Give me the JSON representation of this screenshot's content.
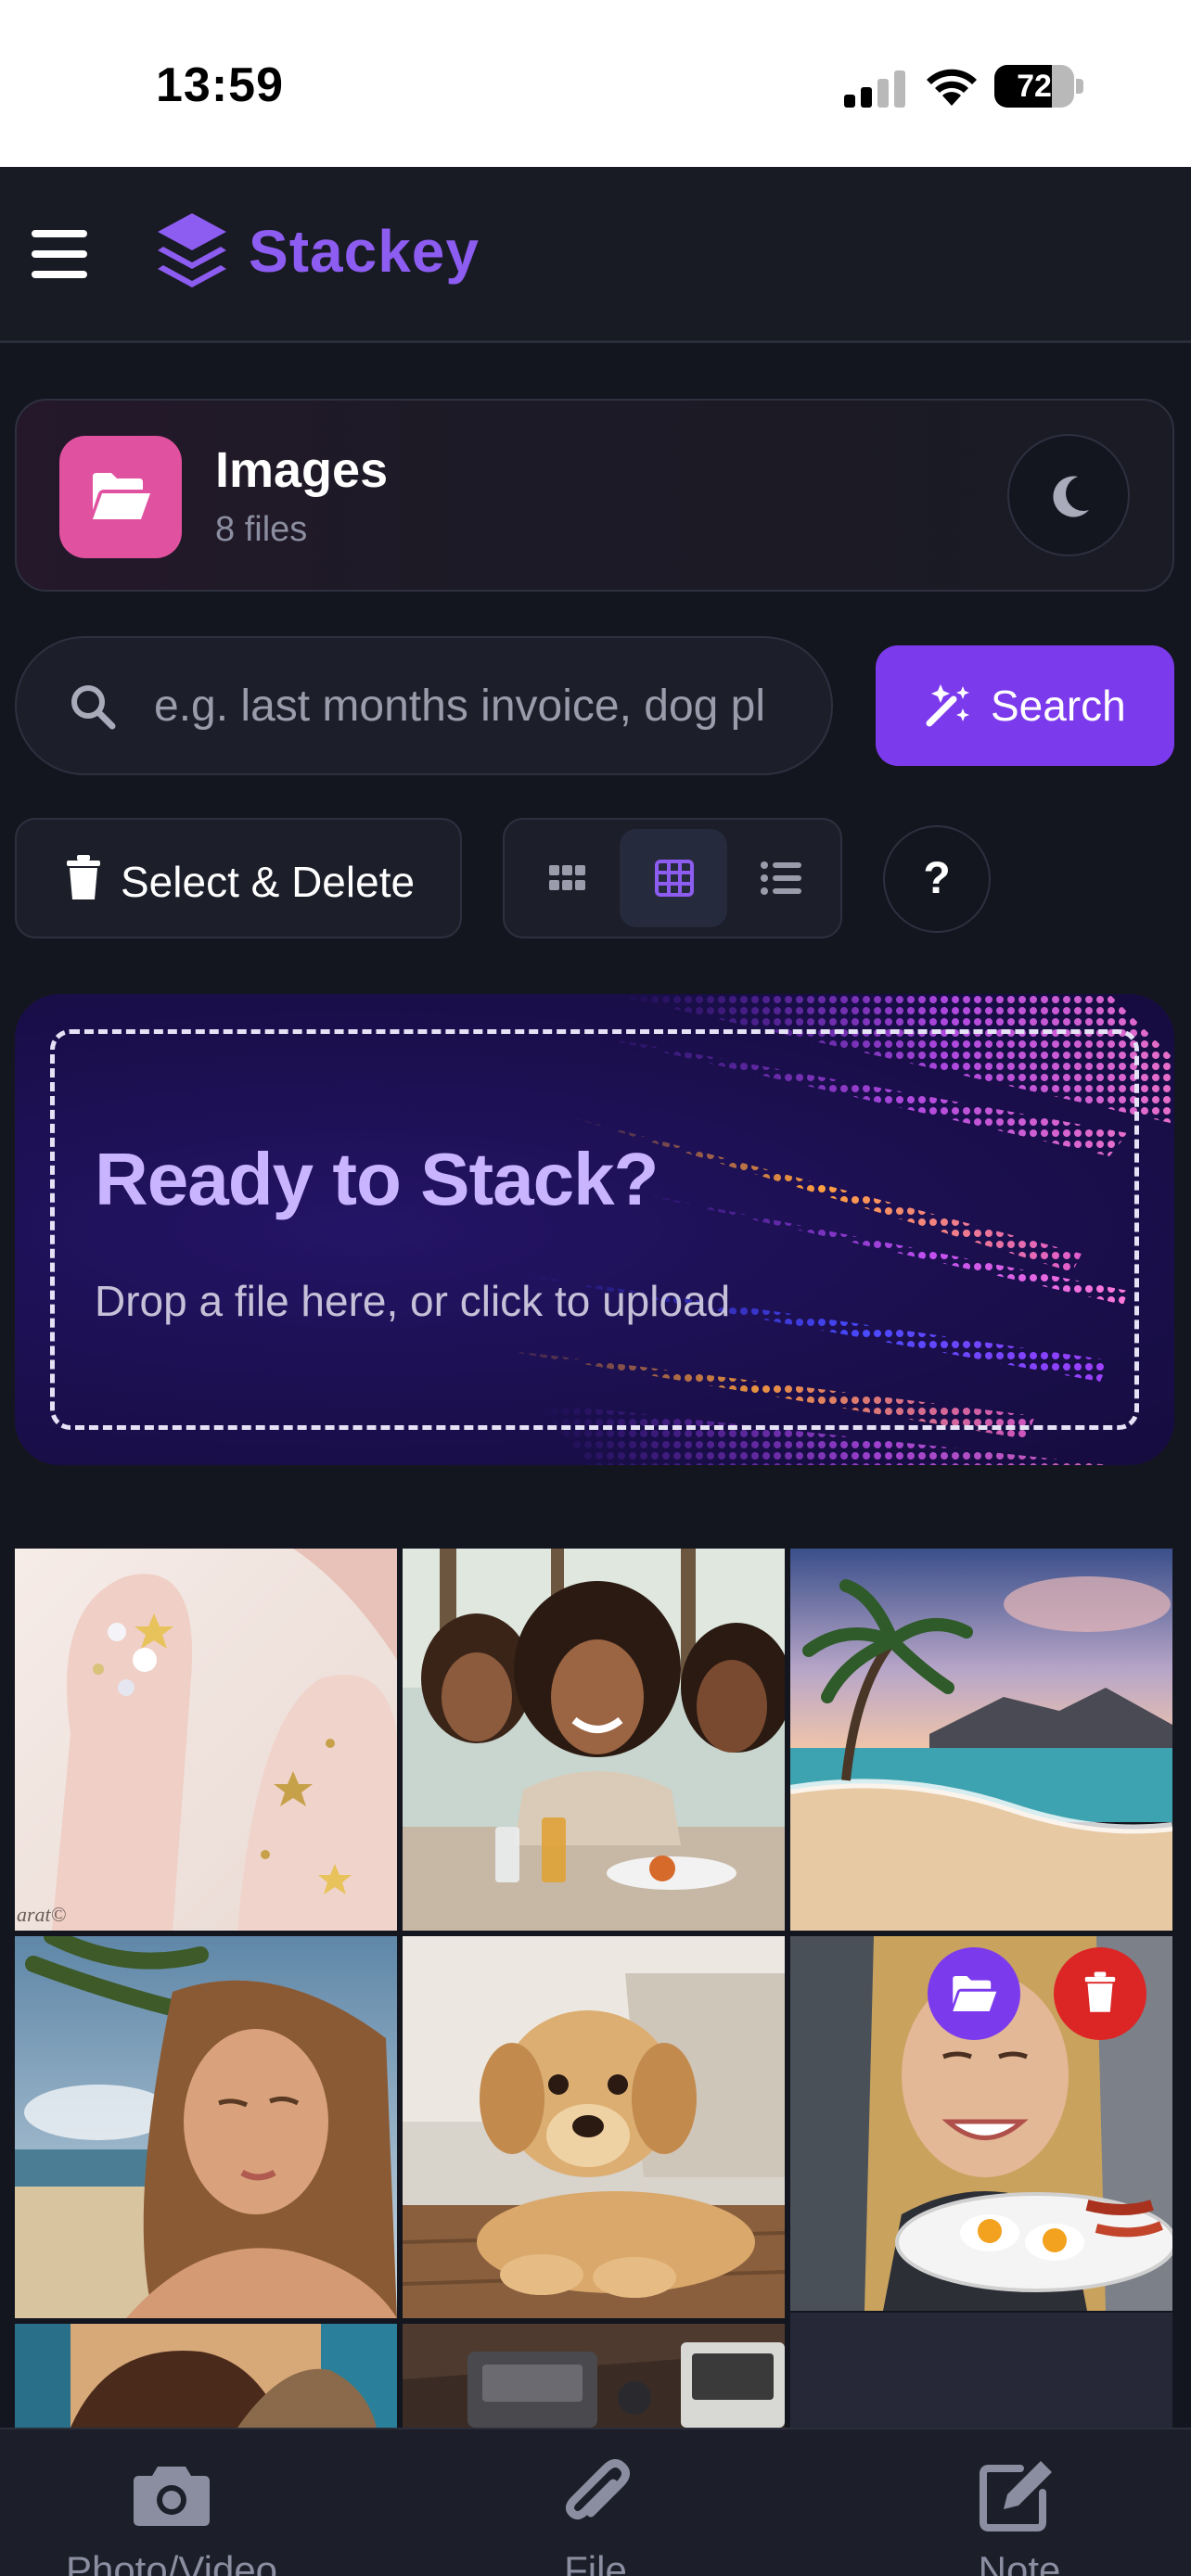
{
  "status_bar": {
    "time": "13:59",
    "battery": "72",
    "battery_level": 0.72
  },
  "header": {
    "app_name": "Stackey"
  },
  "folder": {
    "name": "Images",
    "file_count": "8 files"
  },
  "search": {
    "placeholder": "e.g. last months invoice, dog pl",
    "button_label": "Search"
  },
  "toolbar": {
    "select_delete_label": "Select & Delete",
    "help_label": "?",
    "active_view": "grid-medium"
  },
  "upload": {
    "title": "Ready to Stack?",
    "subtitle": "Drop a file here, or click to upload"
  },
  "images": [
    {
      "subject": "nail art with gems and stars",
      "watermark": "arat©"
    },
    {
      "subject": "women laughing at a restaurant table"
    },
    {
      "subject": "tropical beach with palm trees"
    },
    {
      "subject": "woman relaxing in the sun on a beach"
    },
    {
      "subject": "golden retriever puppy on wooden floor"
    },
    {
      "subject": "smiling woman holding breakfast plate"
    },
    {
      "subject": "partially visible photo"
    },
    {
      "subject": "partially visible electronic device"
    }
  ],
  "tabs": [
    {
      "label": "Photo/Video",
      "icon": "camera-icon"
    },
    {
      "label": "File",
      "icon": "paperclip-icon"
    },
    {
      "label": "Note",
      "icon": "pencil-square-icon"
    }
  ],
  "colors": {
    "accent": "#7c3aed",
    "logo": "#8d5cf0",
    "folder_badge": "#e0519f",
    "delete": "#dc2626",
    "background": "#14161f"
  }
}
